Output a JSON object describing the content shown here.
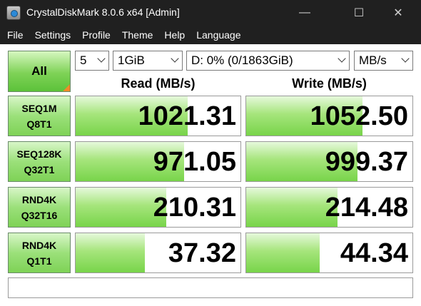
{
  "window": {
    "title": "CrystalDiskMark 8.0.6 x64 [Admin]"
  },
  "menu": [
    "File",
    "Settings",
    "Profile",
    "Theme",
    "Help",
    "Language"
  ],
  "controls": {
    "all_label": "All",
    "count": "5",
    "size": "1GiB",
    "drive": "D: 0% (0/1863GiB)",
    "unit": "MB/s"
  },
  "headers": {
    "read": "Read (MB/s)",
    "write": "Write (MB/s)"
  },
  "tests": [
    {
      "line1": "SEQ1M",
      "line2": "Q8T1",
      "read": "1021.31",
      "write": "1052.50",
      "read_fill": 0.68,
      "write_fill": 0.7
    },
    {
      "line1": "SEQ128K",
      "line2": "Q32T1",
      "read": "971.05",
      "write": "999.37",
      "read_fill": 0.66,
      "write_fill": 0.67
    },
    {
      "line1": "RND4K",
      "line2": "Q32T16",
      "read": "210.31",
      "write": "214.48",
      "read_fill": 0.55,
      "write_fill": 0.55
    },
    {
      "line1": "RND4K",
      "line2": "Q1T1",
      "read": "37.32",
      "write": "44.34",
      "read_fill": 0.42,
      "write_fill": 0.44
    }
  ],
  "status": ""
}
